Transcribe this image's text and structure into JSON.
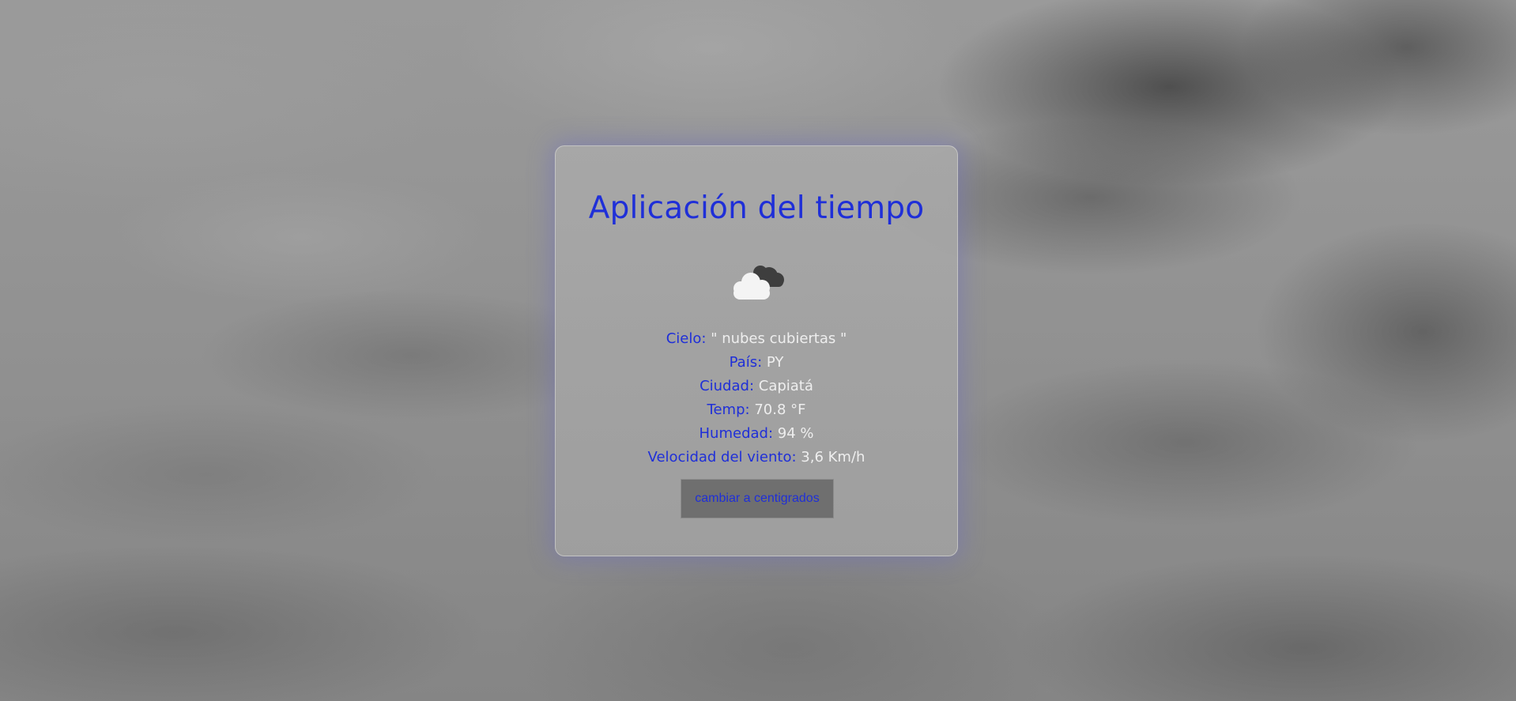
{
  "app": {
    "title": "Aplicación del tiempo"
  },
  "weather": {
    "icon": "overcast-clouds-icon",
    "rows": [
      {
        "label": "Cielo:",
        "value": "\" nubes cubiertas \""
      },
      {
        "label": "País:",
        "value": "PY"
      },
      {
        "label": "Ciudad:",
        "value": "Capiatá"
      },
      {
        "label": "Temp:",
        "value": "70.8 °F"
      },
      {
        "label": "Humedad:",
        "value": "94 %"
      },
      {
        "label": "Velocidad del viento:",
        "value": "3,6 Km/h"
      }
    ]
  },
  "actions": {
    "toggle_units_label": "cambiar a centigrados"
  },
  "colors": {
    "accent": "#1f2fd8",
    "value_text": "#eeeeee",
    "button_bg": "#6f6f6f"
  }
}
